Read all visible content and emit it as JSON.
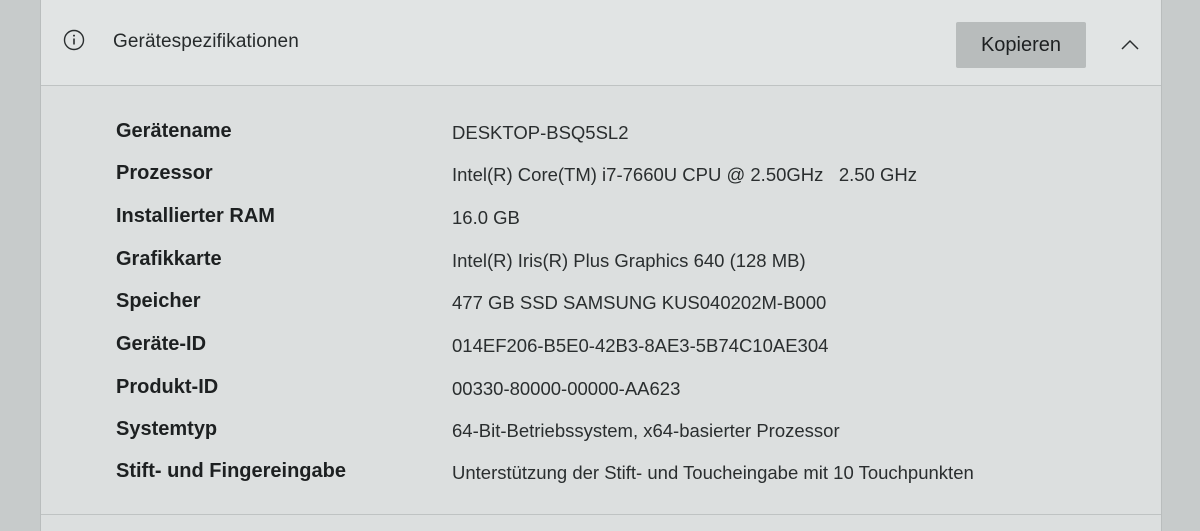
{
  "header": {
    "title": "Gerätespezifikationen",
    "copy_label": "Kopieren"
  },
  "icons": {
    "info": "info-icon",
    "collapse": "chevron-up-icon"
  },
  "specs": [
    {
      "label": "Gerätename",
      "value": "DESKTOP-BSQ5SL2"
    },
    {
      "label": "Prozessor",
      "value": "Intel(R) Core(TM) i7-7660U CPU @ 2.50GHz   2.50 GHz"
    },
    {
      "label": "Installierter RAM",
      "value": "16.0 GB"
    },
    {
      "label": "Grafikkarte",
      "value": "Intel(R) Iris(R) Plus Graphics 640 (128 MB)"
    },
    {
      "label": "Speicher",
      "value": "477 GB SSD SAMSUNG KUS040202M-B000"
    },
    {
      "label": "Geräte-ID",
      "value": "014EF206-B5E0-42B3-8AE3-5B74C10AE304"
    },
    {
      "label": "Produkt-ID",
      "value": "00330-80000-00000-AA623"
    },
    {
      "label": "Systemtyp",
      "value": "64-Bit-Betriebssystem, x64-basierter Prozessor"
    },
    {
      "label": "Stift- und Fingereingabe",
      "value": "Unterstützung der Stift- und Toucheingabe mit 10 Touchpunkten"
    }
  ]
}
